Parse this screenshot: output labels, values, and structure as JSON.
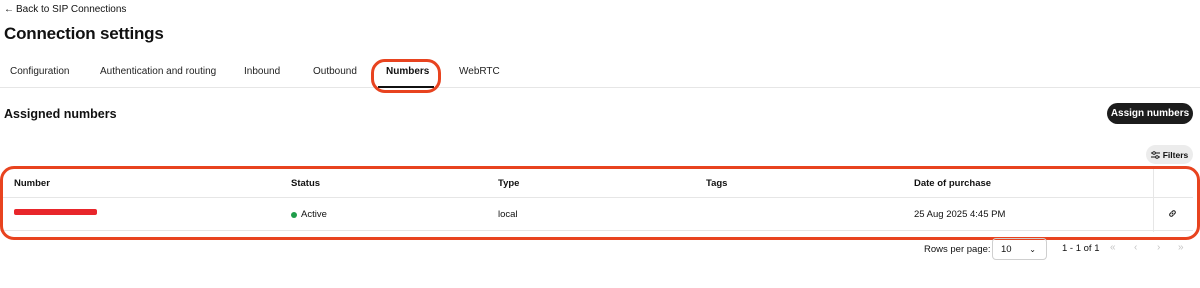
{
  "back_link": {
    "label": "Back to SIP Connections"
  },
  "page_title": "Connection settings",
  "tabs": [
    {
      "label": "Configuration"
    },
    {
      "label": "Authentication and routing"
    },
    {
      "label": "Inbound"
    },
    {
      "label": "Outbound"
    },
    {
      "label": "Numbers",
      "active": true
    },
    {
      "label": "WebRTC"
    }
  ],
  "section": {
    "title": "Assigned numbers",
    "assign_button": "Assign numbers",
    "filters_button": "Filters"
  },
  "table": {
    "headers": [
      "Number",
      "Status",
      "Type",
      "Tags",
      "Date of purchase"
    ],
    "rows": [
      {
        "number": "",
        "status": "Active",
        "type": "local",
        "tags": "",
        "date": "25 Aug 2025 4:45 PM"
      }
    ]
  },
  "pagination": {
    "rows_per_page_label": "Rows per page:",
    "rows_per_page_value": "10",
    "range": "1 - 1 of 1"
  },
  "colors": {
    "highlight": "#e8431f",
    "redaction": "#e8262b",
    "status_active": "#1f9d4a",
    "primary_button": "#1c1c1c"
  }
}
